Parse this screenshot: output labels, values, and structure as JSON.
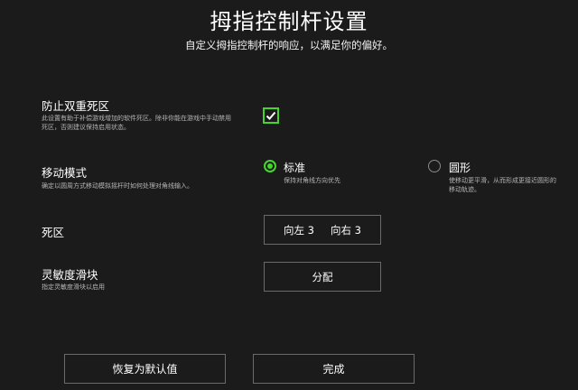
{
  "header": {
    "title": "拇指控制杆设置",
    "subtitle": "自定义拇指控制杆的响应，以满足你的偏好。"
  },
  "settings": {
    "anti_deadzone": {
      "label": "防止双重死区",
      "description_line1": "此设置有助于补偿游戏增加的软件死区。除非你能在游戏中手动禁用",
      "description_line2": "死区，否则建议保持启用状态。",
      "checked": true
    },
    "movement_mode": {
      "label": "移动模式",
      "description": "确定以圆周方式移动模拟摇杆时如何处理对角线输入。",
      "options": [
        {
          "label": "标准",
          "description_line1": "保持对角线方向优先",
          "description_line2": "",
          "selected": true
        },
        {
          "label": "圆形",
          "description_line1": "使移动更平滑，从而形成更接近圆形的",
          "description_line2": "移动轨迹。",
          "selected": false
        }
      ]
    },
    "deadzone": {
      "label": "死区",
      "left_value": "向左 3",
      "right_value": "向右 3"
    },
    "sensitivity_slider": {
      "label": "灵敏度滑块",
      "description": "指定灵敏度滑块以启用",
      "button_label": "分配"
    }
  },
  "footer": {
    "reset_label": "恢复为默认值",
    "done_label": "完成"
  },
  "colors": {
    "background": "#1b1b1b",
    "accent": "#44d62c",
    "border": "#6a6a6a"
  }
}
